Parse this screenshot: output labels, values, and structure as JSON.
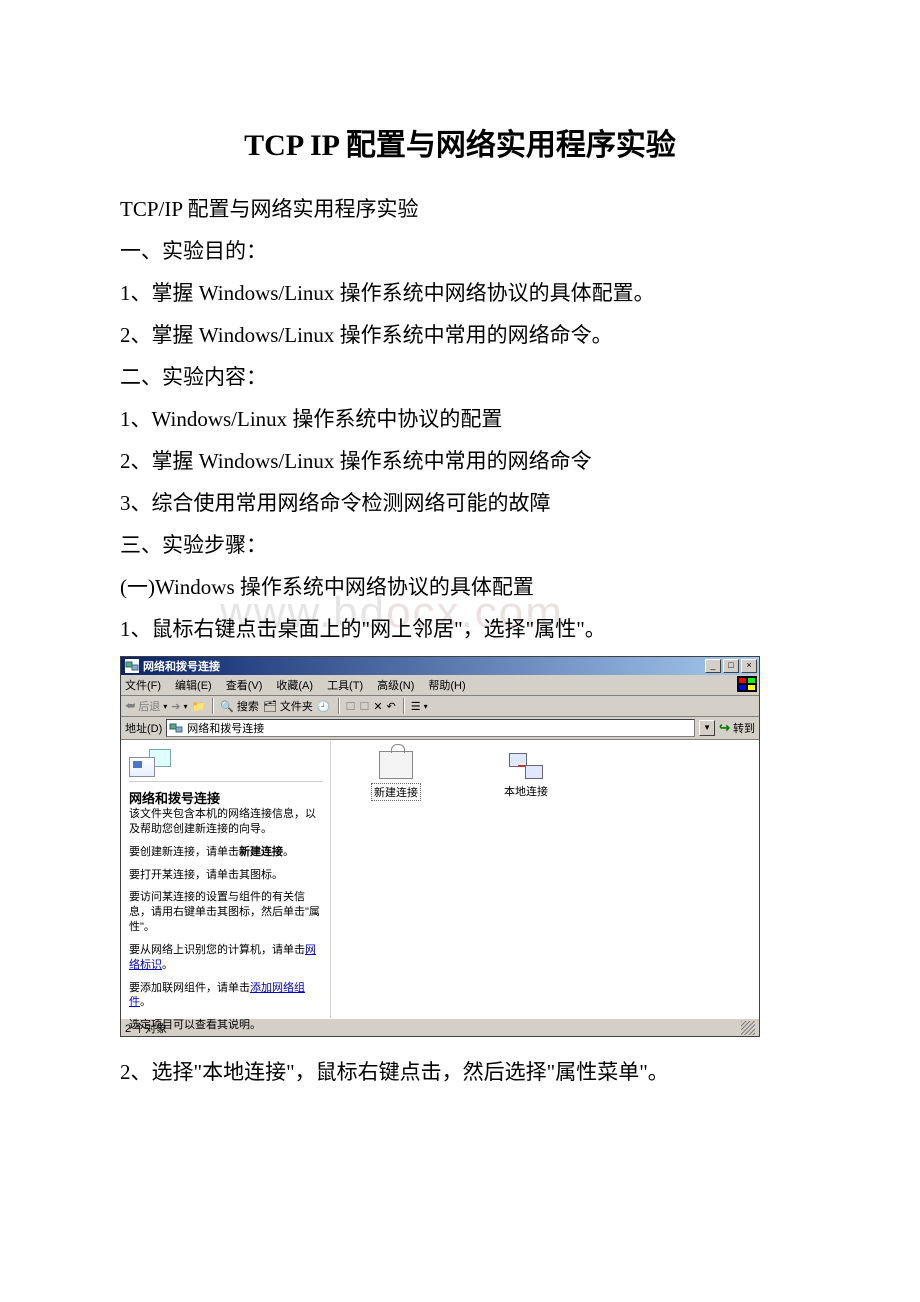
{
  "doc": {
    "title": "TCP IP 配置与网络实用程序实验",
    "subtitle": "TCP/IP 配置与网络实用程序实验",
    "sec1_heading": "一、实验目的：",
    "sec1_item1": " 1、掌握 Windows/Linux 操作系统中网络协议的具体配置。",
    "sec1_item2": " 2、掌握 Windows/Linux 操作系统中常用的网络命令。",
    "sec2_heading": "二、实验内容：",
    "sec2_item1": "1、Windows/Linux 操作系统中协议的配置",
    "sec2_item2": "2、掌握 Windows/Linux 操作系统中常用的网络命令",
    "sec2_item3": " 3、综合使用常用网络命令检测网络可能的故障",
    "sec3_heading": "三、实验步骤：",
    "step_a": " (一)Windows 操作系统中网络协议的具体配置",
    "step_1": "1、鼠标右键点击桌面上的\"网上邻居\"，选择\"属性\"。",
    "step_2": "2、选择\"本地连接\"，鼠标右键点击，然后选择\"属性菜单\"。"
  },
  "watermark": {
    "main": "www.bd",
    "tail": "ocx.com"
  },
  "win": {
    "title": "网络和拨号连接",
    "menu": {
      "file": "文件(F)",
      "edit": "编辑(E)",
      "view": "查看(V)",
      "fav": "收藏(A)",
      "tools": "工具(T)",
      "adv": "高级(N)",
      "help": "帮助(H)"
    },
    "toolbar": {
      "back": "后退",
      "search": "搜索",
      "folders": "文件夹",
      "views": "查看"
    },
    "addr": {
      "label": "地址(D)",
      "value": "网络和拨号连接",
      "go": "转到"
    },
    "leftpane": {
      "title": "网络和拨号连接",
      "p1": "该文件夹包含本机的网络连接信息，以及帮助您创建新连接的向导。",
      "p2_a": "要创建新连接，请单击",
      "p2_b": "新建连接",
      "p2_c": "。",
      "p3": "要打开某连接，请单击其图标。",
      "p4": "要访问某连接的设置与组件的有关信息，请用右键单击其图标，然后单击\"属性\"。",
      "p5_a": "要从网络上识别您的计算机，请单击",
      "p5_link": "网络标识",
      "p5_b": "。",
      "p6_a": "要添加联网组件，请单击",
      "p6_link": "添加网络组件",
      "p6_b": "。",
      "p7": "选定项目可以查看其说明。"
    },
    "icons": {
      "new": "新建连接",
      "local": "本地连接"
    },
    "status": "2 个对象"
  }
}
